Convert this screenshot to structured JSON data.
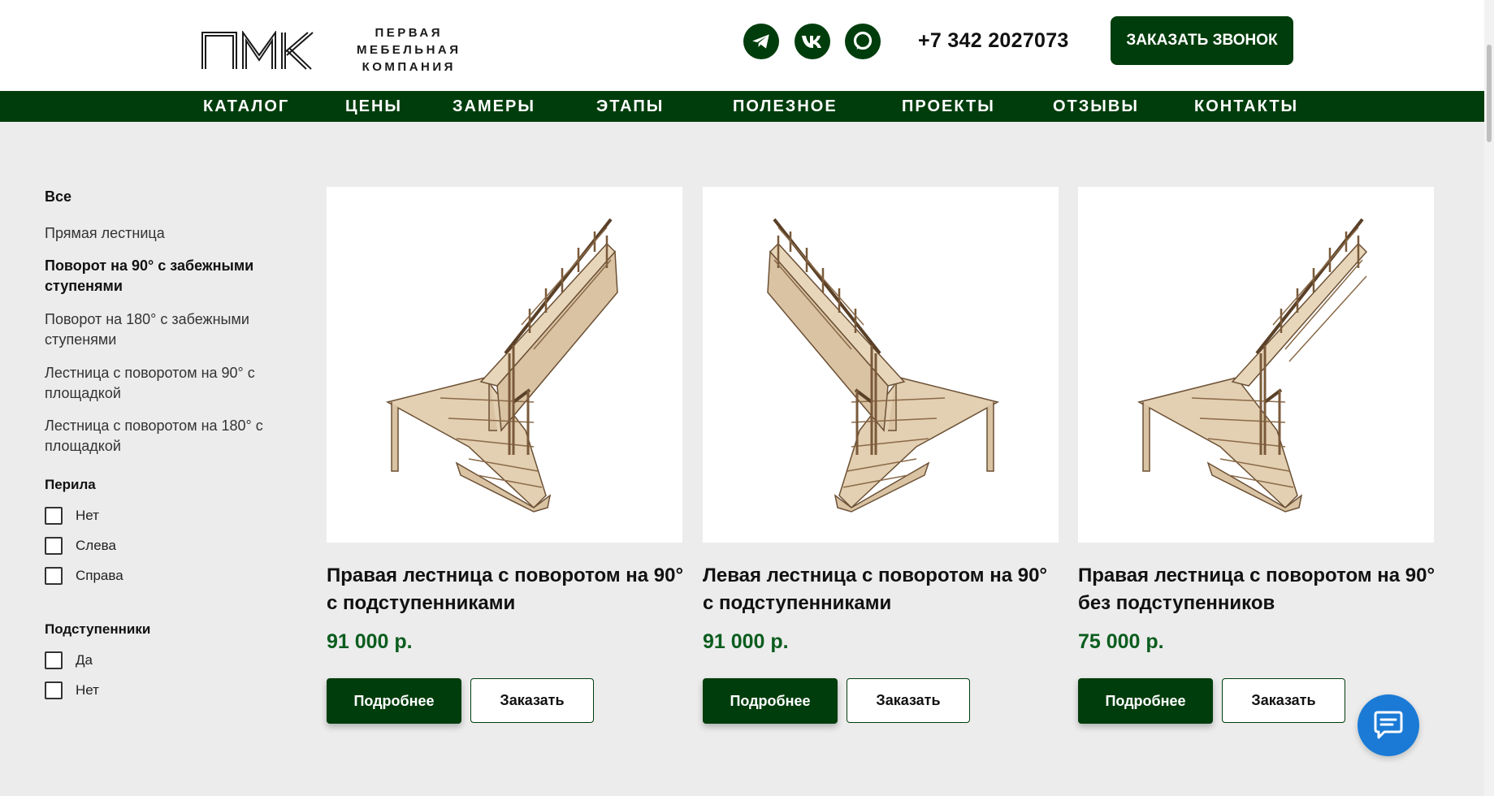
{
  "logo": {
    "lines": [
      "ПЕРВАЯ",
      "МЕБЕЛЬНАЯ",
      "КОМПАНИЯ"
    ]
  },
  "social": [
    "telegram-icon",
    "vk-icon",
    "max-messenger-icon"
  ],
  "phone": "+7 342 2027073",
  "call_button": "ЗАКАЗАТЬ ЗВОНОК",
  "nav": [
    "КАТАЛОГ",
    "ЦЕНЫ",
    "ЗАМЕРЫ",
    "ЭТАПЫ",
    "ПОЛЕЗНОЕ",
    "ПРОЕКТЫ",
    "ОТЗЫВЫ",
    "КОНТАКТЫ"
  ],
  "sidebar": {
    "categories": [
      {
        "label": "Все",
        "active": false
      },
      {
        "label": "Прямая лестница",
        "active": false
      },
      {
        "label": "Поворот на 90° с забежными ступенями",
        "active": true
      },
      {
        "label": "Поворот на 180° с забежными ступенями",
        "active": false
      },
      {
        "label": "Лестница с поворотом на 90° с площадкой",
        "active": false
      },
      {
        "label": "Лестница с поворотом на 180° с площадкой",
        "active": false
      }
    ],
    "railing": {
      "title": "Перила",
      "options": [
        "Нет",
        "Слева",
        "Справа"
      ]
    },
    "risers": {
      "title": "Подступенники",
      "options": [
        "Да",
        "Нет"
      ]
    }
  },
  "products": [
    {
      "title": "Правая лестница с поворотом на 90° с подступенниками",
      "price": "91 000 р.",
      "more": "Подробнее",
      "order": "Заказать"
    },
    {
      "title": "Левая лестница с поворотом на 90° с подступенниками",
      "price": "91 000 р.",
      "more": "Подробнее",
      "order": "Заказать"
    },
    {
      "title": "Правая лестница с поворотом на 90° без подступенников",
      "price": "75 000 р.",
      "more": "Подробнее",
      "order": "Заказать"
    }
  ],
  "colors": {
    "brand": "#003d0c",
    "price": "#0b5d1e",
    "chat": "#1a7ad6",
    "wood": "#c8ab86"
  }
}
